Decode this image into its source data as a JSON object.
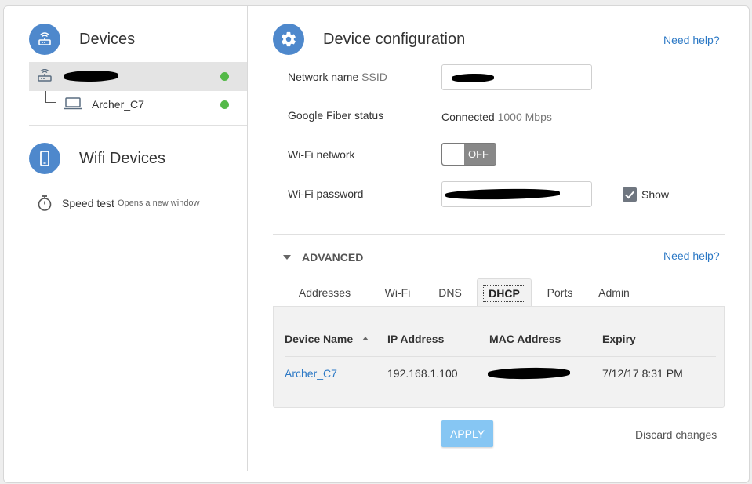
{
  "left": {
    "devices_title": "Devices",
    "devices": [
      {
        "name": "",
        "status": "online"
      },
      {
        "name": "Archer_C7",
        "status": "online"
      }
    ],
    "wifi_title": "Wifi Devices",
    "speed_test": {
      "label": "Speed test",
      "sub": "Opens a new window"
    }
  },
  "main": {
    "title": "Device configuration",
    "help_link": "Need help?",
    "network_name": {
      "label": "Network name",
      "label_suffix": "SSID",
      "value": ""
    },
    "fiber_status": {
      "label": "Google Fiber status",
      "value": "Connected",
      "speed": "1000 Mbps"
    },
    "wifi_network": {
      "label": "Wi-Fi network",
      "toggle": "OFF"
    },
    "wifi_password": {
      "label": "Wi-Fi password",
      "value": "",
      "show_label": "Show",
      "show_checked": true
    },
    "advanced": {
      "label": "ADVANCED",
      "help_link": "Need help?",
      "tabs": [
        "Addresses",
        "Wi-Fi",
        "DNS",
        "DHCP",
        "Ports",
        "Admin"
      ],
      "active_tab": "DHCP",
      "table": {
        "headers": [
          "Device Name",
          "IP Address",
          "MAC Address",
          "Expiry"
        ],
        "rows": [
          {
            "device_name": "Archer_C7",
            "ip": "192.168.1.100",
            "mac": "",
            "expiry": "7/12/17 8:31 PM"
          }
        ]
      }
    },
    "apply_label": "APPLY",
    "discard_label": "Discard changes"
  },
  "colors": {
    "accent": "#4e88cc",
    "link": "#2b78c5",
    "online": "#54b948",
    "apply": "#86c6f3"
  }
}
